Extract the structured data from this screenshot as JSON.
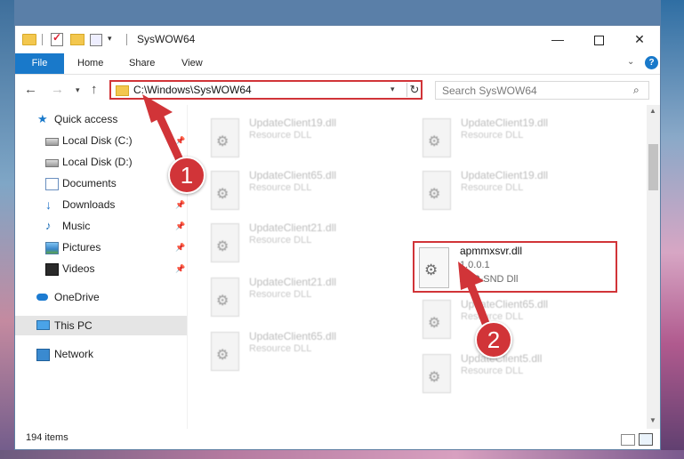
{
  "window": {
    "title": "SysWOW64",
    "controls": {
      "minimize": "—",
      "maximize": "",
      "close": "✕"
    }
  },
  "ribbon": {
    "tabs": [
      "File",
      "Home",
      "Share",
      "View"
    ],
    "help": "?"
  },
  "nav": {
    "back": "←",
    "forward": "→",
    "recent": "▾",
    "up": "↑"
  },
  "address": {
    "path": "C:\\Windows\\SysWOW64",
    "dropdown": "▾",
    "refresh": "↻"
  },
  "search": {
    "placeholder": "Search SysWOW64",
    "icon": "search-icon"
  },
  "sidebar": {
    "items": [
      {
        "label": "Quick access",
        "icon": "star-icon"
      },
      {
        "label": "Local Disk (C:)",
        "icon": "disk-icon",
        "pinned": true
      },
      {
        "label": "Local Disk (D:)",
        "icon": "disk-icon",
        "pinned": false
      },
      {
        "label": "Documents",
        "icon": "documents-icon",
        "pinned": true
      },
      {
        "label": "Downloads",
        "icon": "downloads-icon",
        "pinned": true
      },
      {
        "label": "Music",
        "icon": "music-icon",
        "pinned": true
      },
      {
        "label": "Pictures",
        "icon": "pictures-icon",
        "pinned": true
      },
      {
        "label": "Videos",
        "icon": "videos-icon",
        "pinned": true
      },
      {
        "label": "OneDrive",
        "icon": "onedrive-icon"
      },
      {
        "label": "This PC",
        "icon": "pc-icon"
      },
      {
        "label": "Network",
        "icon": "network-icon"
      }
    ],
    "pin_glyph": "📌"
  },
  "files": [
    {
      "name": "UpdateClient19.dll",
      "type": "Resource DLL"
    },
    {
      "name": "UpdateClient19.dll",
      "type": "Resource DLL"
    },
    {
      "name": "UpdateClient65.dll",
      "type": "Resource DLL"
    },
    {
      "name": "UpdateClient19.dll",
      "type": "Resource DLL"
    },
    {
      "name": "UpdateClient21.dll",
      "type": "Resource DLL"
    },
    {
      "name": "UpdateClient21.dll",
      "type": "Resource DLL"
    },
    {
      "name": "UpdateClient65.dll",
      "type": "Resource DLL"
    },
    {
      "name": "UpdateClient65.dll",
      "type": "Resource DLL"
    },
    {
      "name": "UpdateClient5.dll",
      "type": "Resource DLL"
    }
  ],
  "highlighted_file": {
    "name": "apmmxsvr.dll",
    "version": "1.0.0.1",
    "description": "ACP-SND Dll"
  },
  "status": {
    "item_count": "194 items"
  },
  "annotations": {
    "step1": "1",
    "step2": "2",
    "color": "#d13438"
  },
  "colors": {
    "accent": "#1979ca",
    "highlight": "#d13438"
  }
}
